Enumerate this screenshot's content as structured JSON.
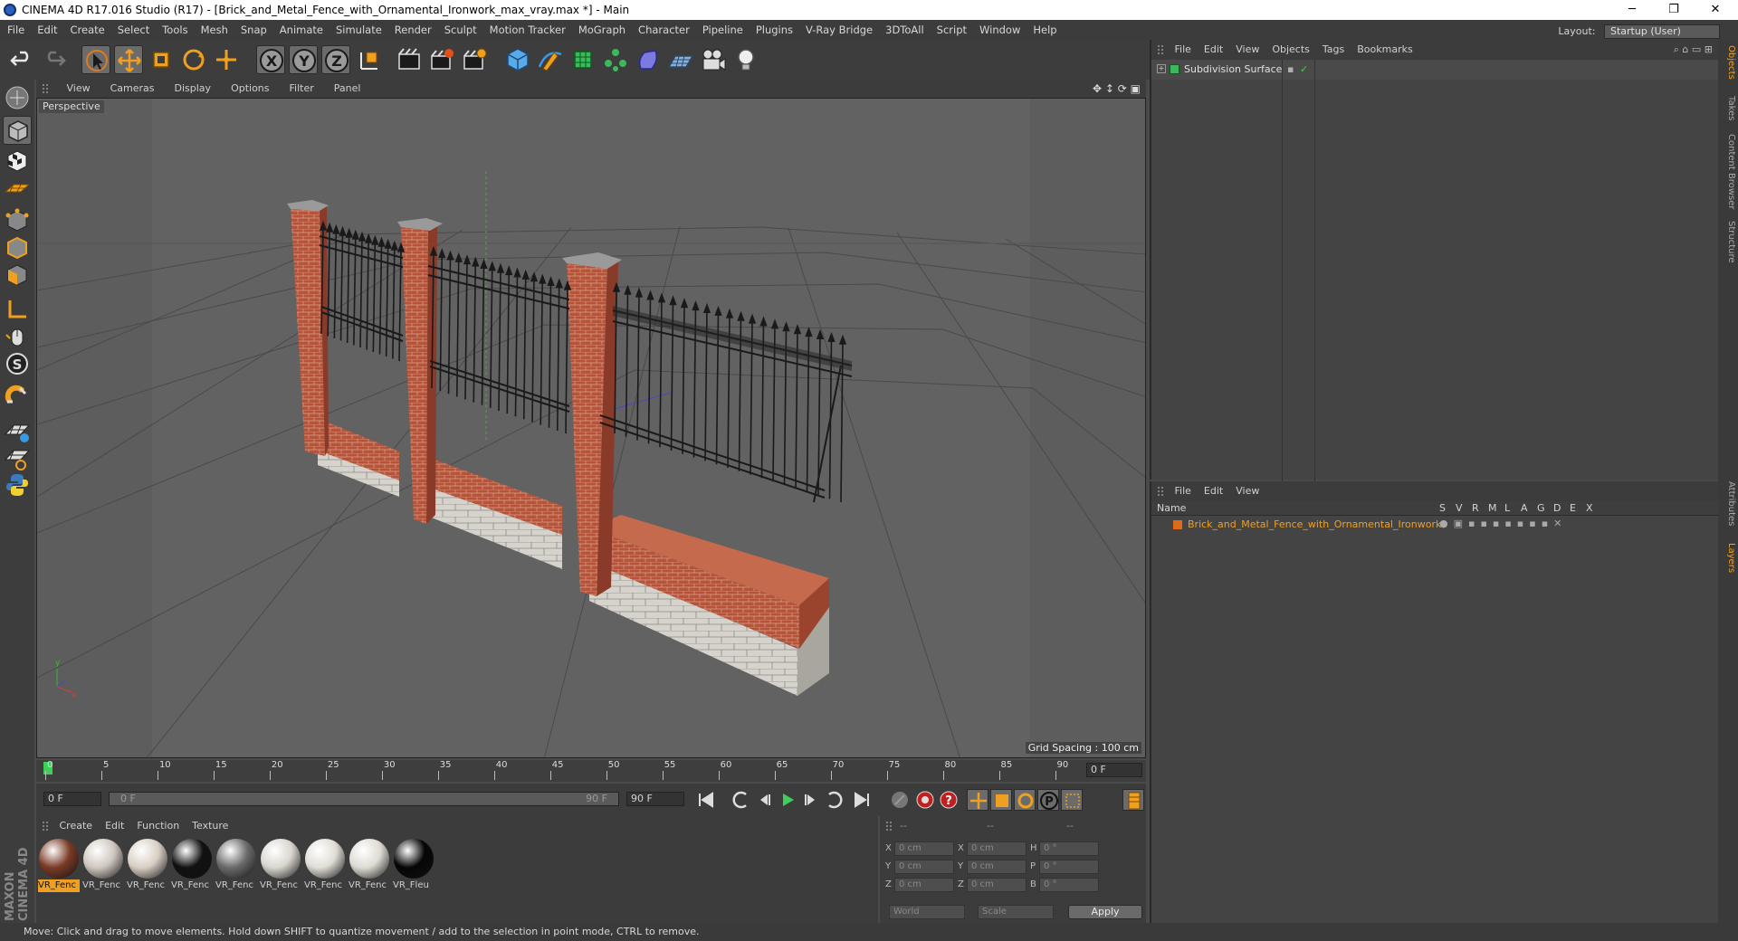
{
  "window": {
    "title": "CINEMA 4D R17.016 Studio (R17) - [Brick_and_Metal_Fence_with_Ornamental_Ironwork_max_vray.max *] - Main",
    "minimize": "─",
    "restore": "❐",
    "close": "✕"
  },
  "menubar": {
    "items": [
      "File",
      "Edit",
      "Create",
      "Select",
      "Tools",
      "Mesh",
      "Snap",
      "Animate",
      "Simulate",
      "Render",
      "Sculpt",
      "Motion Tracker",
      "MoGraph",
      "Character",
      "Pipeline",
      "Plugins",
      "V-Ray Bridge",
      "3DToAll",
      "Script",
      "Window",
      "Help"
    ],
    "layout_label": "Layout:",
    "layout_value": "Startup (User)"
  },
  "toolbar": {
    "icons": [
      "undo-icon",
      "redo-icon",
      "select-icon",
      "move-icon",
      "scale-icon",
      "rotate-icon",
      "live-select-icon",
      "x-axis-icon",
      "y-axis-icon",
      "z-axis-icon",
      "coordinate-system-icon",
      "render-view-icon",
      "render-picture-viewer-icon",
      "edit-render-settings-icon",
      "cube-icon",
      "pen-icon",
      "subdivision-icon",
      "array-icon",
      "deformer-icon",
      "floor-icon",
      "camera-icon",
      "light-icon"
    ],
    "axis_labels": [
      "X",
      "Y",
      "Z"
    ]
  },
  "viewport": {
    "menu": [
      "View",
      "Cameras",
      "Display",
      "Options",
      "Filter",
      "Panel"
    ],
    "label": "Perspective",
    "grid_spacing": "Grid Spacing : 100 cm"
  },
  "timeline": {
    "ticks": [
      "0",
      "5",
      "10",
      "15",
      "20",
      "25",
      "30",
      "35",
      "40",
      "45",
      "50",
      "55",
      "60",
      "65",
      "70",
      "75",
      "80",
      "85",
      "90"
    ],
    "current_frame": "0 F"
  },
  "playbar": {
    "start_frame": "0 F",
    "range_start": "0 F",
    "range_end": "90 F",
    "end_frame": "90 F"
  },
  "materials": {
    "menu": [
      "Create",
      "Edit",
      "Function",
      "Texture"
    ],
    "items": [
      {
        "label": "VR_Fenc",
        "color": "#7a3b26",
        "selected": true
      },
      {
        "label": "VR_Fenc",
        "color": "#cfc7bf",
        "selected": false
      },
      {
        "label": "VR_Fenc",
        "color": "#d8cfc5",
        "selected": false
      },
      {
        "label": "VR_Fenc",
        "color": "#111111",
        "selected": false
      },
      {
        "label": "VR_Fenc",
        "color": "#6a6a6a",
        "selected": false
      },
      {
        "label": "VR_Fenc",
        "color": "#d9d6cf",
        "selected": false
      },
      {
        "label": "VR_Fenc",
        "color": "#e0ddd6",
        "selected": false
      },
      {
        "label": "VR_Fenc",
        "color": "#dedbd4",
        "selected": false
      },
      {
        "label": "VR_Fleu",
        "color": "#050505",
        "selected": false
      }
    ]
  },
  "coords": {
    "headers": [
      "--",
      "--",
      "--"
    ],
    "rows": [
      {
        "a": "X",
        "av": "0 cm",
        "b": "X",
        "bv": "0 cm",
        "c": "H",
        "cv": "0 °"
      },
      {
        "a": "Y",
        "av": "0 cm",
        "b": "Y",
        "bv": "0 cm",
        "c": "P",
        "cv": "0 °"
      },
      {
        "a": "Z",
        "av": "0 cm",
        "b": "Z",
        "bv": "0 cm",
        "c": "B",
        "cv": "0 °"
      }
    ],
    "world": "World",
    "scale": "Scale",
    "apply": "Apply"
  },
  "objects": {
    "menu": [
      "File",
      "Edit",
      "View",
      "Objects",
      "Tags",
      "Bookmarks"
    ],
    "items": [
      {
        "name": "Subdivision Surface"
      }
    ]
  },
  "layers": {
    "menu": [
      "File",
      "Edit",
      "View"
    ],
    "columns": [
      "Name",
      "S",
      "V",
      "R",
      "M",
      "L",
      "A",
      "G",
      "D",
      "E",
      "X"
    ],
    "items": [
      {
        "name": "Brick_and_Metal_Fence_with_Ornamental_Ironwork",
        "color": "#e06a1a"
      }
    ]
  },
  "right_tabs": [
    "Objects",
    "Takes",
    "Content Browser",
    "Structure",
    "Attributes",
    "Layers"
  ],
  "status": "Move: Click and drag to move elements. Hold down SHIFT to quantize movement / add to the selection in point mode, CTRL to remove.",
  "brand": "MAXON CINEMA 4D"
}
